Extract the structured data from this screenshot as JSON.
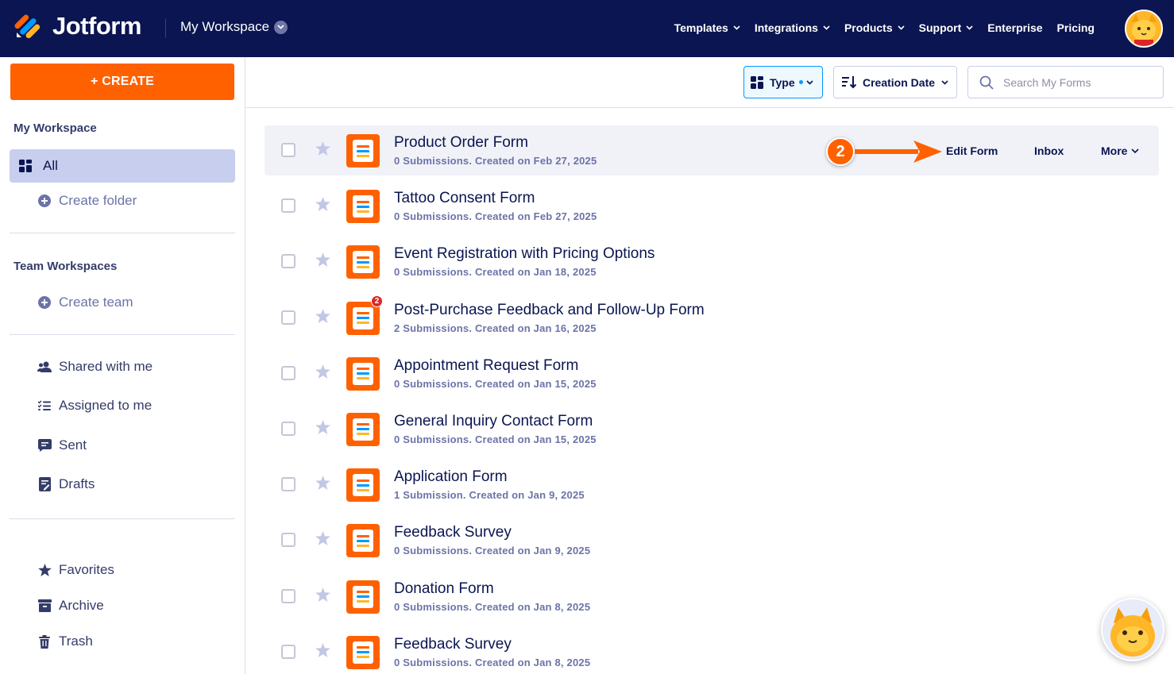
{
  "header": {
    "brand": "Jotform",
    "workspace": "My Workspace",
    "nav": [
      {
        "label": "Templates"
      },
      {
        "label": "Integrations"
      },
      {
        "label": "Products"
      },
      {
        "label": "Support"
      },
      {
        "label": "Enterprise"
      },
      {
        "label": "Pricing"
      }
    ]
  },
  "sidebar": {
    "create_label": "+ CREATE",
    "my_workspace_heading": "My Workspace",
    "all_label": "All",
    "create_folder_label": "Create folder",
    "team_heading": "Team Workspaces",
    "create_team_label": "Create team",
    "shared_label": "Shared with me",
    "assigned_label": "Assigned to me",
    "sent_label": "Sent",
    "drafts_label": "Drafts",
    "favorites_label": "Favorites",
    "archive_label": "Archive",
    "trash_label": "Trash"
  },
  "toolbar": {
    "type_label": "Type",
    "sort_label": "Creation Date",
    "search_placeholder": "Search My Forms"
  },
  "forms": [
    {
      "title": "Product Order Form",
      "meta": "0 Submissions. Created on Feb 27, 2025"
    },
    {
      "title": "Tattoo Consent Form",
      "meta": "0 Submissions. Created on Feb 27, 2025"
    },
    {
      "title": "Event Registration with Pricing Options",
      "meta": "0 Submissions. Created on Jan 18, 2025"
    },
    {
      "title": "Post-Purchase Feedback and Follow-Up Form",
      "meta": "2 Submissions. Created on Jan 16, 2025",
      "badge": "2"
    },
    {
      "title": "Appointment Request Form",
      "meta": "0 Submissions. Created on Jan 15, 2025"
    },
    {
      "title": "General Inquiry Contact Form",
      "meta": "0 Submissions. Created on Jan 15, 2025"
    },
    {
      "title": "Application Form",
      "meta": "1 Submission. Created on Jan 9, 2025"
    },
    {
      "title": "Feedback Survey",
      "meta": "0 Submissions. Created on Jan 9, 2025"
    },
    {
      "title": "Donation Form",
      "meta": "0 Submissions. Created on Jan 8, 2025"
    },
    {
      "title": "Feedback Survey",
      "meta": "0 Submissions. Created on Jan 8, 2025"
    }
  ],
  "row_actions": {
    "edit": "Edit Form",
    "inbox": "Inbox",
    "more": "More"
  },
  "annotation": {
    "step": "2"
  },
  "colors": {
    "navy": "#0a1551",
    "orange": "#ff6100",
    "active_bg": "#c8ceed",
    "hover_row": "#f1f2f8",
    "type_accent": "#0099ff"
  }
}
